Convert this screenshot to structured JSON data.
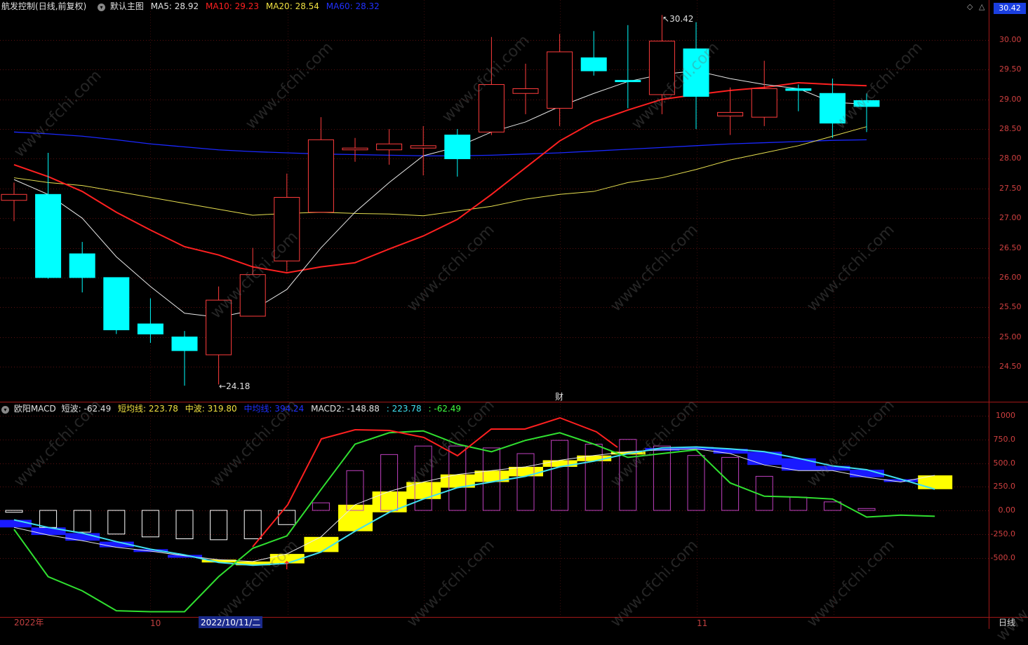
{
  "main_panel": {
    "stock_name": "航发控制",
    "mode": "(日线,前复权)",
    "template_label": "默认主图",
    "indicators": [
      {
        "label": "MA5:",
        "value": "28.92",
        "color": "#e0e0e0"
      },
      {
        "label": "MA10:",
        "value": "29.23",
        "color": "#ff2020"
      },
      {
        "label": "MA20:",
        "value": "28.54",
        "color": "#f0e040"
      },
      {
        "label": "MA60:",
        "value": "28.32",
        "color": "#2030ff"
      }
    ],
    "current_price": "30.42",
    "high_marker": "30.42",
    "low_marker": "24.18",
    "cai_marker": "财",
    "y_ticks": [
      "30.00",
      "29.50",
      "29.00",
      "28.50",
      "28.00",
      "27.50",
      "27.00",
      "26.50",
      "26.00",
      "25.50",
      "25.00",
      "24.50"
    ]
  },
  "macd_panel": {
    "name": "欧阳MACD",
    "values": [
      {
        "label": "短波:",
        "value": "-62.49",
        "color": "#e0e0e0"
      },
      {
        "label": "短均线:",
        "value": "223.78",
        "color": "#f0e040"
      },
      {
        "label": "中波:",
        "value": "319.80",
        "color": "#f0e040"
      },
      {
        "label": "中均线:",
        "value": "394.24",
        "color": "#2030ff"
      },
      {
        "label": "MACD2:",
        "value": "-148.88",
        "color": "#e0e0e0"
      },
      {
        "label": ":",
        "value": "223.78",
        "color": "#40e0f0"
      },
      {
        "label": ":",
        "value": "-62.49",
        "color": "#40ff40"
      }
    ],
    "y_ticks": [
      "1000",
      "750.0",
      "500.0",
      "250.0",
      "0.00",
      "-250.0",
      "-500.0"
    ]
  },
  "x_axis": {
    "labels": [
      "2022年",
      "10",
      "11"
    ],
    "selected_date": "2022/10/11/二",
    "period": "日线"
  },
  "watermark": "www.cfchi.com",
  "chart_data": {
    "type": "candlestick",
    "candles": [
      {
        "o": 27.3,
        "c": 27.4,
        "h": 27.6,
        "l": 26.95
      },
      {
        "o": 27.4,
        "c": 26.0,
        "h": 28.1,
        "l": 25.98
      },
      {
        "o": 26.4,
        "c": 26.0,
        "h": 26.6,
        "l": 25.75
      },
      {
        "o": 26.0,
        "c": 25.12,
        "h": 26.0,
        "l": 25.05
      },
      {
        "o": 25.22,
        "c": 25.05,
        "h": 25.65,
        "l": 24.9
      },
      {
        "o": 25.0,
        "c": 24.77,
        "h": 25.1,
        "l": 24.18
      },
      {
        "o": 24.7,
        "c": 25.62,
        "h": 25.85,
        "l": 24.2
      },
      {
        "o": 25.35,
        "c": 26.05,
        "h": 26.5,
        "l": 25.35
      },
      {
        "o": 26.28,
        "c": 27.35,
        "h": 27.75,
        "l": 26.1
      },
      {
        "o": 27.1,
        "c": 28.32,
        "h": 28.7,
        "l": 27.1
      },
      {
        "o": 28.15,
        "c": 28.18,
        "h": 28.35,
        "l": 27.95
      },
      {
        "o": 28.15,
        "c": 28.25,
        "h": 28.5,
        "l": 27.9
      },
      {
        "o": 28.18,
        "c": 28.22,
        "h": 28.55,
        "l": 27.72
      },
      {
        "o": 28.4,
        "c": 28.0,
        "h": 28.5,
        "l": 27.7
      },
      {
        "o": 28.45,
        "c": 29.25,
        "h": 30.05,
        "l": 28.4
      },
      {
        "o": 29.1,
        "c": 29.18,
        "h": 29.6,
        "l": 28.75
      },
      {
        "o": 28.85,
        "c": 29.8,
        "h": 30.1,
        "l": 28.55
      },
      {
        "o": 29.7,
        "c": 29.48,
        "h": 30.15,
        "l": 29.4
      },
      {
        "o": 29.32,
        "c": 29.3,
        "h": 30.25,
        "l": 28.85
      },
      {
        "o": 29.08,
        "c": 29.98,
        "h": 30.42,
        "l": 28.75
      },
      {
        "o": 29.85,
        "c": 29.05,
        "h": 30.3,
        "l": 28.5
      },
      {
        "o": 28.72,
        "c": 28.78,
        "h": 29.2,
        "l": 28.4
      },
      {
        "o": 28.7,
        "c": 29.18,
        "h": 29.65,
        "l": 28.55
      },
      {
        "o": 29.18,
        "c": 29.15,
        "h": 29.25,
        "l": 28.8
      },
      {
        "o": 29.1,
        "c": 28.6,
        "h": 29.35,
        "l": 28.35
      },
      {
        "o": 28.98,
        "c": 28.88,
        "h": 29.1,
        "l": 28.45
      }
    ],
    "ma5": [
      27.65,
      27.4,
      27.0,
      26.35,
      25.85,
      25.4,
      25.33,
      25.45,
      25.8,
      26.5,
      27.1,
      27.6,
      28.05,
      28.2,
      28.45,
      28.62,
      28.88,
      29.1,
      29.3,
      29.42,
      29.48,
      29.35,
      29.25,
      29.18,
      28.95,
      28.92
    ],
    "ma10": [
      27.9,
      27.7,
      27.45,
      27.1,
      26.8,
      26.52,
      26.38,
      26.18,
      26.08,
      26.18,
      26.25,
      26.48,
      26.7,
      26.98,
      27.4,
      27.85,
      28.3,
      28.62,
      28.82,
      29.0,
      29.08,
      29.15,
      29.2,
      29.28,
      29.25,
      29.23
    ],
    "ma20": [
      27.68,
      27.6,
      27.55,
      27.45,
      27.35,
      27.25,
      27.15,
      27.05,
      27.08,
      27.1,
      27.08,
      27.07,
      27.04,
      27.12,
      27.2,
      27.32,
      27.4,
      27.45,
      27.6,
      27.68,
      27.82,
      27.98,
      28.1,
      28.22,
      28.38,
      28.54
    ],
    "ma60": [
      28.45,
      28.42,
      28.38,
      28.32,
      28.25,
      28.2,
      28.15,
      28.12,
      28.1,
      28.08,
      28.07,
      28.06,
      28.05,
      28.05,
      28.06,
      28.08,
      28.1,
      28.13,
      28.16,
      28.19,
      28.22,
      28.25,
      28.27,
      28.29,
      28.31,
      28.32
    ],
    "macd_bars": [
      -20,
      -180,
      -230,
      -250,
      -280,
      -300,
      -310,
      -300,
      -150,
      80,
      420,
      590,
      680,
      680,
      660,
      600,
      740,
      700,
      750,
      680,
      580,
      560,
      360,
      140,
      90,
      20,
      -100,
      -140
    ],
    "short_avg": [
      -180,
      -260,
      -320,
      -390,
      -430,
      -480,
      -520,
      -540,
      -460,
      -280,
      60,
      200,
      300,
      380,
      420,
      460,
      530,
      580,
      620,
      640,
      650,
      600,
      480,
      420,
      420,
      350,
      300,
      370
    ],
    "mid_line": [
      -100,
      -180,
      -240,
      -330,
      -410,
      -470,
      -550,
      -580,
      -560,
      -440,
      -220,
      -20,
      120,
      240,
      300,
      360,
      460,
      520,
      600,
      660,
      670,
      650,
      620,
      550,
      470,
      430,
      330,
      224
    ],
    "green_line": [
      -200,
      -700,
      -850,
      -1060,
      -1070,
      -1070,
      -700,
      -400,
      -270,
      220,
      700,
      820,
      840,
      700,
      620,
      740,
      820,
      700,
      560,
      600,
      640,
      290,
      150,
      140,
      120,
      -70,
      -50,
      -62
    ]
  }
}
